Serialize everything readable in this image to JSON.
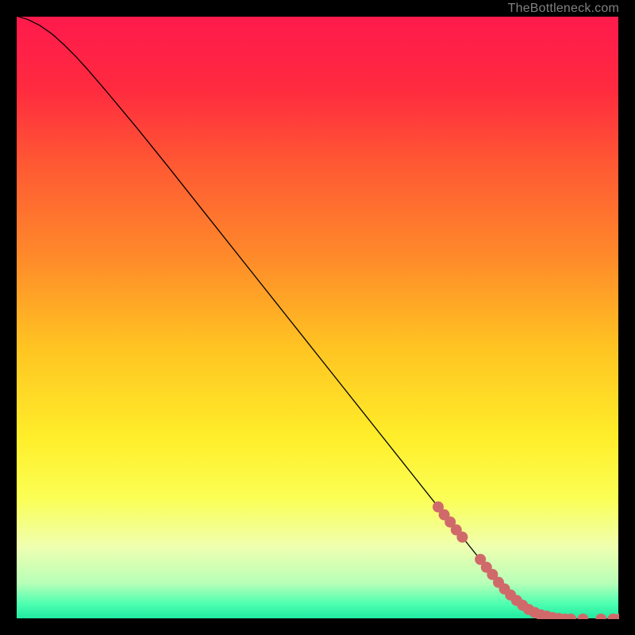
{
  "watermark": "TheBottleneck.com",
  "chart_data": {
    "type": "line",
    "title": "",
    "xlabel": "",
    "ylabel": "",
    "xlim": [
      0,
      100
    ],
    "ylim": [
      0,
      100
    ],
    "background_gradient": {
      "stops": [
        {
          "offset": 0.0,
          "color": "#ff1a4d"
        },
        {
          "offset": 0.12,
          "color": "#ff2a3f"
        },
        {
          "offset": 0.25,
          "color": "#ff5a33"
        },
        {
          "offset": 0.4,
          "color": "#ff8a2a"
        },
        {
          "offset": 0.55,
          "color": "#ffc422"
        },
        {
          "offset": 0.7,
          "color": "#ffee2a"
        },
        {
          "offset": 0.8,
          "color": "#fbff55"
        },
        {
          "offset": 0.88,
          "color": "#efffb0"
        },
        {
          "offset": 0.94,
          "color": "#b8ffb8"
        },
        {
          "offset": 0.975,
          "color": "#4dffb0"
        },
        {
          "offset": 1.0,
          "color": "#1de9a0"
        }
      ]
    },
    "series": [
      {
        "name": "curve",
        "stroke": "#000000",
        "stroke_width": 1.3,
        "x": [
          0,
          2,
          4,
          6,
          8,
          10,
          12,
          15,
          20,
          25,
          30,
          35,
          40,
          45,
          50,
          55,
          60,
          65,
          70,
          72,
          74,
          76,
          78,
          80,
          82,
          84,
          86,
          88,
          90,
          92,
          94,
          96,
          98,
          100
        ],
        "y": [
          100.0,
          99.4,
          98.4,
          97.0,
          95.2,
          93.2,
          91.0,
          87.5,
          81.5,
          75.3,
          69.0,
          62.7,
          56.4,
          50.1,
          43.8,
          37.5,
          31.2,
          24.9,
          18.6,
          16.1,
          13.6,
          11.1,
          8.6,
          6.1,
          4.0,
          2.3,
          1.1,
          0.5,
          0.1,
          0.0,
          0.0,
          0.0,
          0.0,
          0.0
        ]
      }
    ],
    "markers": [
      {
        "name": "highlight-dots",
        "color": "#d06a6a",
        "radius": 7,
        "x": [
          70,
          71,
          72,
          73,
          74,
          77,
          78,
          79,
          80,
          81,
          82,
          83,
          84,
          85,
          86,
          87,
          88,
          89,
          90,
          91,
          92,
          94,
          97,
          99,
          100
        ],
        "y": [
          18.6,
          17.3,
          16.1,
          14.8,
          13.6,
          9.9,
          8.6,
          7.4,
          6.1,
          5.0,
          4.0,
          3.1,
          2.3,
          1.6,
          1.1,
          0.7,
          0.5,
          0.25,
          0.1,
          0.0,
          0.0,
          0.0,
          0.0,
          0.0,
          0.0
        ]
      }
    ]
  }
}
